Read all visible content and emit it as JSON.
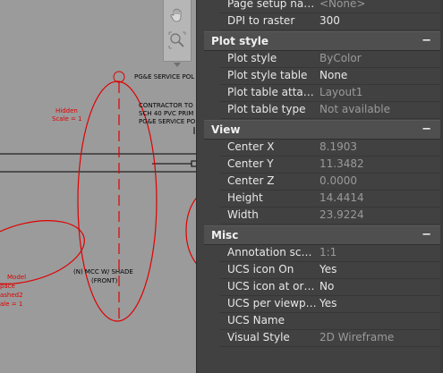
{
  "drawing": {
    "texts": {
      "pge_pole": "PG&E SERVICE POL",
      "contractor_1": "CONTRACTOR TO",
      "contractor_2": "SCH 40 PVC PRIM",
      "contractor_3": "PG&E SERVICE PO",
      "hidden_1": "Hidden",
      "hidden_2": "Scale = 1",
      "model_1": "Model",
      "model_2": "pace",
      "model_3": "ashed2",
      "model_4": "ale = 1",
      "mcc_1": "(N) MCC W/ SHADE",
      "mcc_2": "(FRONT)"
    },
    "line_color": "#e00000"
  },
  "navbar": {
    "pan_icon": "hand-pan-icon",
    "zoom_icon": "zoom-extents-icon"
  },
  "properties": {
    "top_rows": [
      {
        "label": "Page setup name",
        "value": "<None>",
        "dim": true
      },
      {
        "label": "DPI to raster",
        "value": "300",
        "dim": false
      }
    ],
    "plot_style": {
      "title": "Plot style",
      "toggle": "−",
      "rows": [
        {
          "label": "Plot style",
          "value": "ByColor",
          "dim": true
        },
        {
          "label": "Plot style table",
          "value": "None",
          "dim": false
        },
        {
          "label": "Plot table attach...",
          "value": "Layout1",
          "dim": true
        },
        {
          "label": "Plot table type",
          "value": "Not available",
          "dim": true
        }
      ]
    },
    "view": {
      "title": "View",
      "toggle": "−",
      "rows": [
        {
          "label": "Center X",
          "value": "8.1903",
          "dim": true
        },
        {
          "label": "Center Y",
          "value": "11.3482",
          "dim": true
        },
        {
          "label": "Center Z",
          "value": "0.0000",
          "dim": true
        },
        {
          "label": "Height",
          "value": "14.4414",
          "dim": true
        },
        {
          "label": "Width",
          "value": "23.9224",
          "dim": true
        }
      ]
    },
    "misc": {
      "title": "Misc",
      "toggle": "−",
      "rows": [
        {
          "label": "Annotation scale",
          "value": "1:1",
          "dim": true
        },
        {
          "label": "UCS icon On",
          "value": "Yes",
          "dim": false
        },
        {
          "label": "UCS icon at orig...",
          "value": "No",
          "dim": false
        },
        {
          "label": "UCS per viewport",
          "value": "Yes",
          "dim": false
        },
        {
          "label": "UCS Name",
          "value": "",
          "dim": false
        },
        {
          "label": "Visual Style",
          "value": "2D Wireframe",
          "dim": true
        }
      ]
    }
  },
  "colors": {
    "panel_bg": "#414141",
    "section_bg": "#4f4f4f",
    "dim_text": "#9a9a9a"
  }
}
